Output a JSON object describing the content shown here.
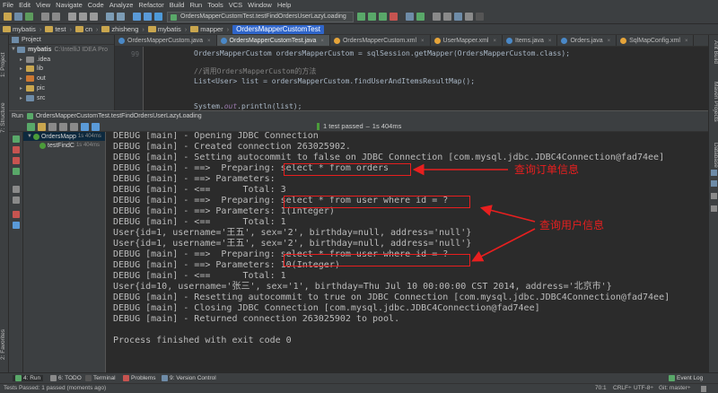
{
  "menu": [
    "File",
    "Edit",
    "View",
    "Navigate",
    "Code",
    "Analyze",
    "Refactor",
    "Build",
    "Run",
    "Tools",
    "VCS",
    "Window",
    "Help"
  ],
  "toolbar": {
    "run_config": "OrdersMapperCustomTest.testFindOrdersUserLazyLoading"
  },
  "breadcrumb": [
    "mybatis",
    "test",
    "cn",
    "zhisheng",
    "mybatis",
    "mapper"
  ],
  "breadcrumb_active": "OrdersMapperCustomTest",
  "left_stripe": {
    "project": "1: Project",
    "structure": "7: Structure",
    "favorites": "2: Favorites"
  },
  "right_stripe": {
    "ant": "Ant Build",
    "maven": "Maven Projects",
    "database": "Database"
  },
  "project": {
    "header": "Project",
    "root": {
      "name": "mybatis",
      "path": "C:\\IntelliJ IDEA Pro"
    },
    "items": [
      {
        "name": ".idea",
        "color": "#8a8a8a"
      },
      {
        "name": "lib",
        "color": "#c9a64e"
      },
      {
        "name": "out",
        "color": "#cc7832"
      },
      {
        "name": "pic",
        "color": "#c9a64e"
      },
      {
        "name": "src",
        "color": "#6e8ca8"
      }
    ]
  },
  "editor_tabs": [
    {
      "label": "OrdersMapperCustom.java",
      "color": "#4a88c7"
    },
    {
      "label": "OrdersMapperCustomTest.java",
      "color": "#4a88c7",
      "active": true
    },
    {
      "label": "OrdersMapperCustom.xml",
      "color": "#e5a43a"
    },
    {
      "label": "UserMapper.xml",
      "color": "#e5a43a"
    },
    {
      "label": "Items.java",
      "color": "#4a88c7"
    },
    {
      "label": "Orders.java",
      "color": "#4a88c7"
    },
    {
      "label": "SqlMapConfig.xml",
      "color": "#e5a43a"
    }
  ],
  "editor": {
    "line_number": "99",
    "line1": "OrdersMapperCustom ordersMapperCustom = sqlSession.getMapper(OrdersMapperCustom.class);",
    "comment": "//调用OrdersMapperCustom的方法",
    "line3": "List<User> list = ordersMapperCustom.findUserAndItemsResultMap();",
    "line4_pre": "System.",
    "line4_kw": "out",
    "line4_post": ".println(list);"
  },
  "run": {
    "header": "Run",
    "config": "OrdersMapperCustomTest.testFindOrdersUserLazyLoading",
    "status": "1 test passed",
    "time": "1s 404ms",
    "tree": [
      {
        "label": "OrdersMapp",
        "time": "1s 404ms"
      },
      {
        "label": "testFindC",
        "time": "1s 404ms"
      }
    ]
  },
  "console": [
    "DEBUG [main] - Opening JDBC Connection",
    "DEBUG [main] - Created connection 263025902.",
    "DEBUG [main] - Setting autocommit to false on JDBC Connection [com.mysql.jdbc.JDBC4Connection@fad74ee]",
    "DEBUG [main] - ==>  Preparing: select * from orders",
    "DEBUG [main] - ==> Parameters: ",
    "DEBUG [main] - <==      Total: 3",
    "DEBUG [main] - ==>  Preparing: select * from user where id = ?",
    "DEBUG [main] - ==> Parameters: 1(Integer)",
    "DEBUG [main] - <==      Total: 1",
    "User{id=1, username='王五', sex='2', birthday=null, address='null'}",
    "User{id=1, username='王五', sex='2', birthday=null, address='null'}",
    "DEBUG [main] - ==>  Preparing: select * from user where id = ?",
    "DEBUG [main] - ==> Parameters: 10(Integer)",
    "DEBUG [main] - <==      Total: 1",
    "User{id=10, username='张三', sex='1', birthday=Thu Jul 10 00:00:00 CST 2014, address='北京市'}",
    "DEBUG [main] - Resetting autocommit to true on JDBC Connection [com.mysql.jdbc.JDBC4Connection@fad74ee]",
    "DEBUG [main] - Closing JDBC Connection [com.mysql.jdbc.JDBC4Connection@fad74ee]",
    "DEBUG [main] - Returned connection 263025902 to pool.",
    "",
    "Process finished with exit code 0"
  ],
  "annotations": {
    "orders": "查询订单信息",
    "user": "查询用户信息"
  },
  "bottom_tabs": {
    "run": "4: Run",
    "todo": "6: TODO",
    "terminal": "Terminal",
    "problems": "Problems",
    "vcs": "9: Version Control",
    "event_log": "Event Log"
  },
  "statusbar": {
    "message": "Tests Passed: 1 passed (moments ago)",
    "position": "70:1",
    "line_sep": "CRLF÷",
    "encoding": "UTF-8÷",
    "git": "Git: master÷"
  },
  "colors": {
    "background": "#2b2b2b",
    "panel": "#3c3f41",
    "highlight": "#e81f1f",
    "success": "#4b9b3a",
    "selection": "#2f65ca"
  }
}
